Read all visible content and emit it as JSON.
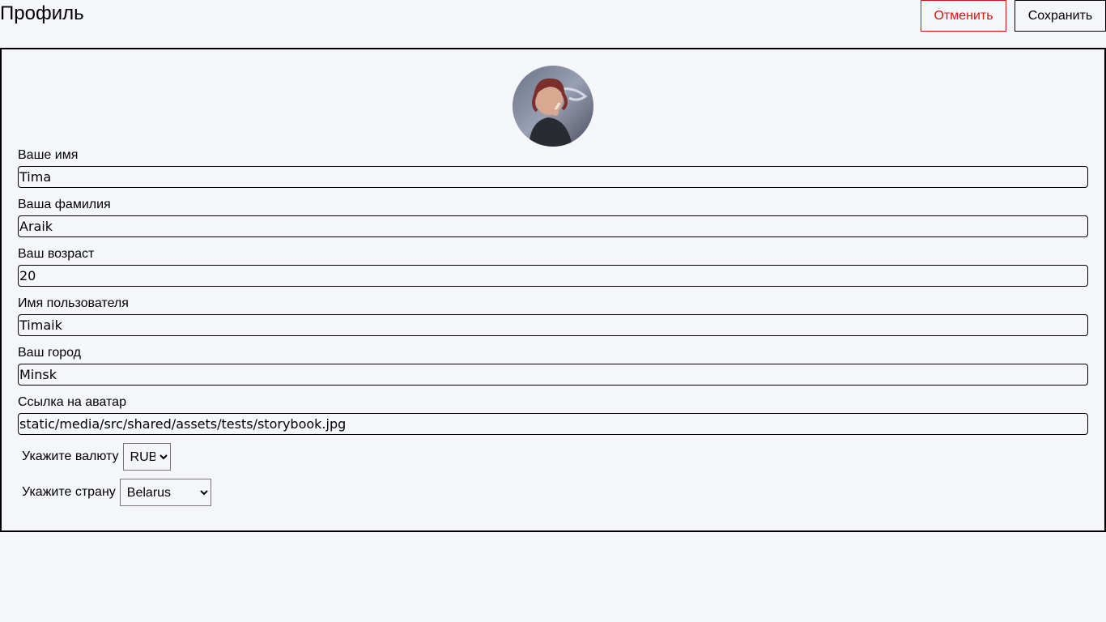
{
  "header": {
    "title": "Профиль",
    "cancel_label": "Отменить",
    "save_label": "Сохранить"
  },
  "profile": {
    "fields": [
      {
        "label": "Ваше имя",
        "value": "Tima"
      },
      {
        "label": "Ваша фамилия",
        "value": "Araik"
      },
      {
        "label": "Ваш возраст",
        "value": "20"
      },
      {
        "label": "Имя пользователя",
        "value": "Timaik"
      },
      {
        "label": "Ваш город",
        "value": "Minsk"
      },
      {
        "label": "Ссылка на аватар",
        "value": "static/media/src/shared/assets/tests/storybook.jpg"
      }
    ],
    "currency": {
      "label": "Укажите валюту",
      "value": "RUB"
    },
    "country": {
      "label": "Укажите страну",
      "value": "Belarus"
    }
  },
  "colors": {
    "background": "#f4f6fa",
    "cancel": "#e01010",
    "border": "#000000"
  }
}
